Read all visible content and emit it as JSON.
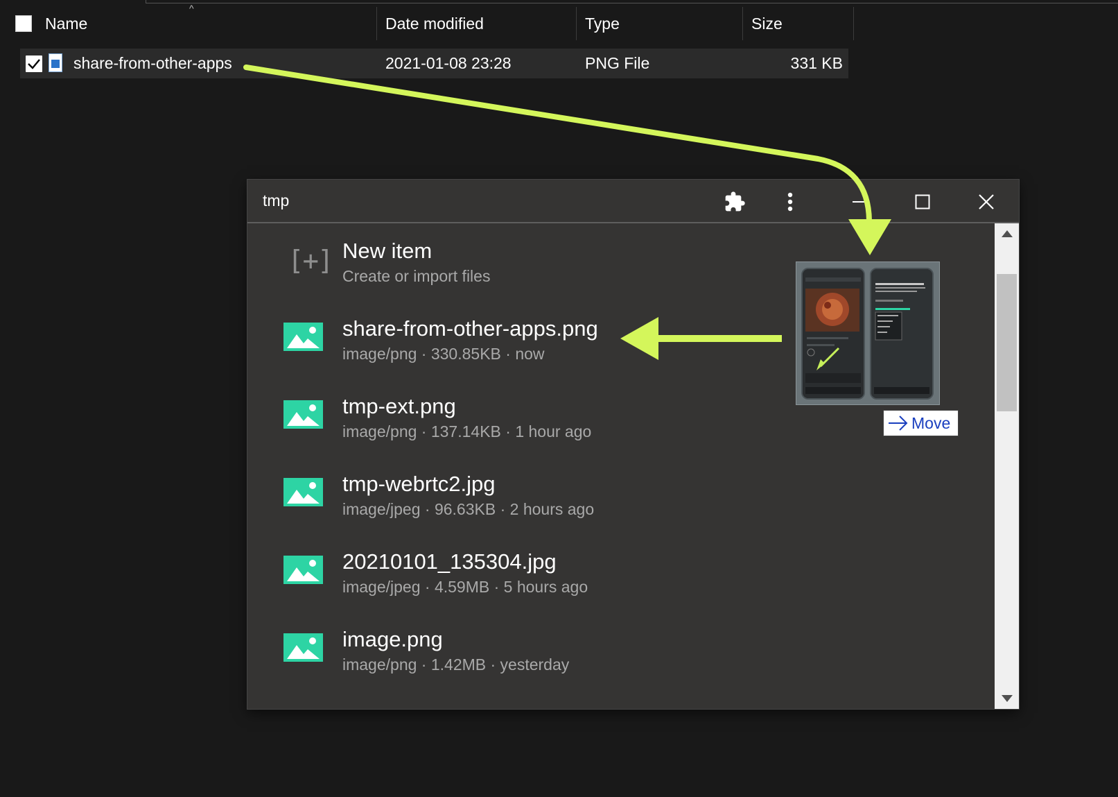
{
  "explorer": {
    "columns": {
      "name": "Name",
      "date_modified": "Date modified",
      "type": "Type",
      "size": "Size"
    },
    "file": {
      "name": "share-from-other-apps",
      "date_modified": "2021-01-08 23:28",
      "type": "PNG File",
      "size": "331 KB",
      "selected": true
    }
  },
  "window": {
    "title": "tmp",
    "toolbar_icons": [
      "puzzle-icon",
      "more-vert-icon",
      "minimize-icon",
      "maximize-icon",
      "close-icon"
    ],
    "new_item": {
      "icon_text": "[+]",
      "title": "New item",
      "subtitle": "Create or import files"
    },
    "items": [
      {
        "name": "share-from-other-apps.png",
        "meta": "image/png · 330.85KB · now"
      },
      {
        "name": "tmp-ext.png",
        "meta": "image/png · 137.14KB · 1 hour ago"
      },
      {
        "name": "tmp-webrtc2.jpg",
        "meta": "image/jpeg · 96.63KB · 2 hours ago"
      },
      {
        "name": "20210101_135304.jpg",
        "meta": "image/jpeg · 4.59MB · 5 hours ago"
      },
      {
        "name": "image.png",
        "meta": "image/png · 1.42MB · yesterday"
      }
    ]
  },
  "drag": {
    "tooltip": "Move"
  },
  "colors": {
    "accent_arrow": "#d4f65b",
    "image_icon": "#2dd4a4",
    "move_text": "#1a3fbf"
  }
}
